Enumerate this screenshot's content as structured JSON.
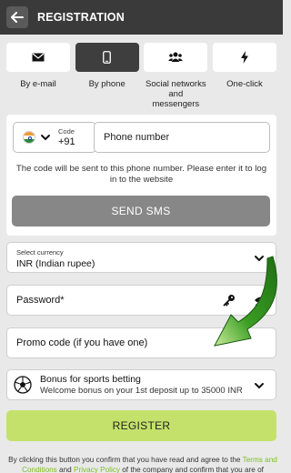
{
  "header": {
    "title": "REGISTRATION",
    "back_icon": "arrow-left-icon"
  },
  "tabs": [
    {
      "label": "By e-mail",
      "icon": "envelope-icon",
      "active": false
    },
    {
      "label": "By phone",
      "icon": "phone-icon",
      "active": true
    },
    {
      "label": "Social networks and messengers",
      "icon": "users-icon",
      "active": false
    },
    {
      "label": "One-click",
      "icon": "lightning-icon",
      "active": false
    }
  ],
  "phone": {
    "code_label": "Code",
    "code_value": "+91",
    "placeholder": "Phone number",
    "note": "The code will be sent to this phone number. Please enter it to log in to the website",
    "send_label": "SEND SMS"
  },
  "currency": {
    "label": "Select currency",
    "value": "INR  (Indian rupee)"
  },
  "password": {
    "label": "Password*"
  },
  "promo": {
    "label": "Promo code (if you have one)"
  },
  "bonus": {
    "title": "Bonus for sports betting",
    "subtitle": "Welcome bonus on your 1st deposit up to 35000 INR"
  },
  "register": {
    "label": "REGISTER"
  },
  "footer": {
    "text_1": "By clicking this button you confirm that you have read and agree to the ",
    "link_terms": "Terms and Conditions",
    "text_2": " and ",
    "link_privacy": "Privacy Policy",
    "text_3": " of the company and confirm that you are of"
  },
  "colors": {
    "header": "#3a3a3a",
    "accent": "#c4e26b",
    "link": "#7bbf1e",
    "arrow": "#2e8b1e",
    "button_gray": "#878787"
  }
}
